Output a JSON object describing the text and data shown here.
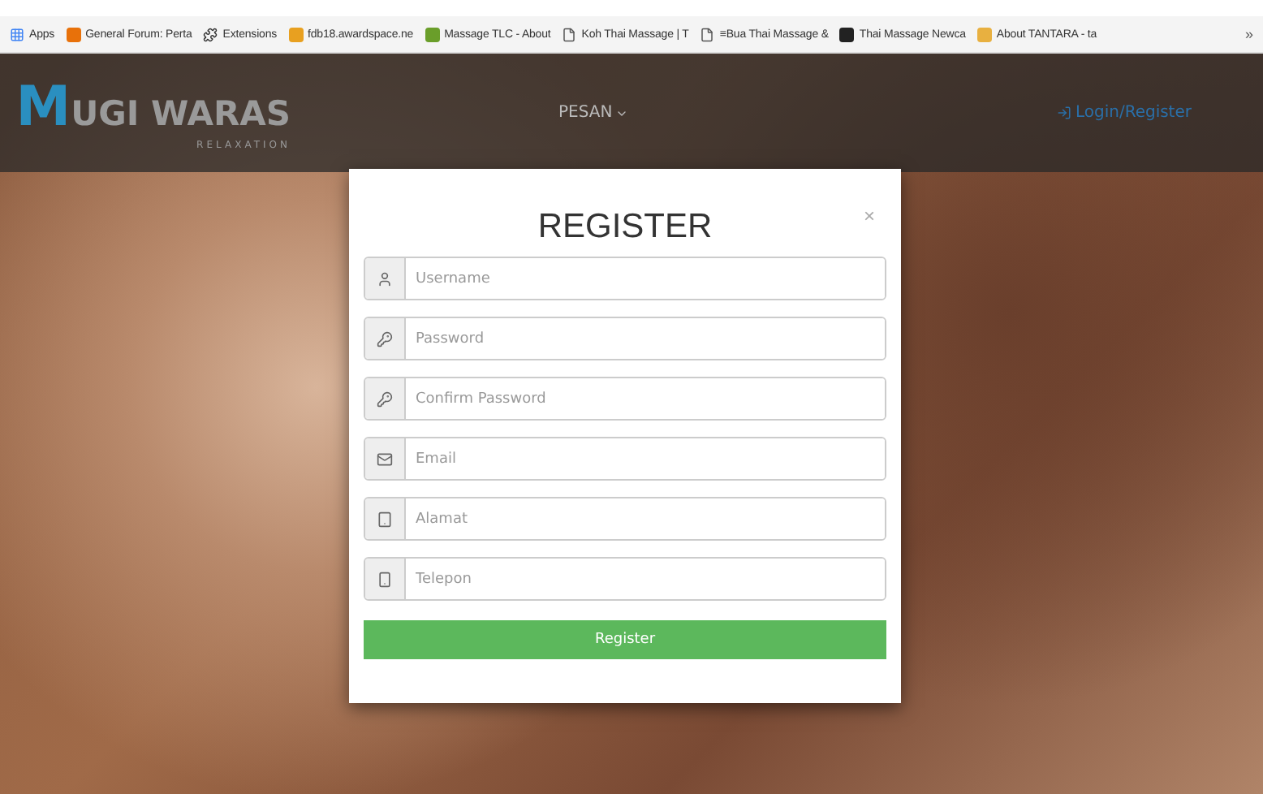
{
  "bookmarks_bar": {
    "items": [
      {
        "label": "Apps"
      },
      {
        "label": "General Forum: Perta"
      },
      {
        "label": "Extensions"
      },
      {
        "label": "fdb18.awardspace.ne"
      },
      {
        "label": "Massage TLC - About"
      },
      {
        "label": "Koh Thai Massage | T"
      },
      {
        "label": "≡Bua Thai Massage &"
      },
      {
        "label": "Thai Massage Newca"
      },
      {
        "label": "About TANTARA - ta"
      }
    ],
    "overflow": "»"
  },
  "header": {
    "logo_initial": "M",
    "logo_text": "UGI WARAS",
    "logo_tagline": "RELAXATION",
    "nav_item": "PESAN",
    "login_link": "Login/Register"
  },
  "modal": {
    "title": "REGISTER",
    "close": "×",
    "fields": [
      {
        "placeholder": "Username"
      },
      {
        "placeholder": "Password"
      },
      {
        "placeholder": "Confirm Password"
      },
      {
        "placeholder": "Email"
      },
      {
        "placeholder": "Alamat"
      },
      {
        "placeholder": "Telepon"
      }
    ],
    "submit": "Register"
  }
}
